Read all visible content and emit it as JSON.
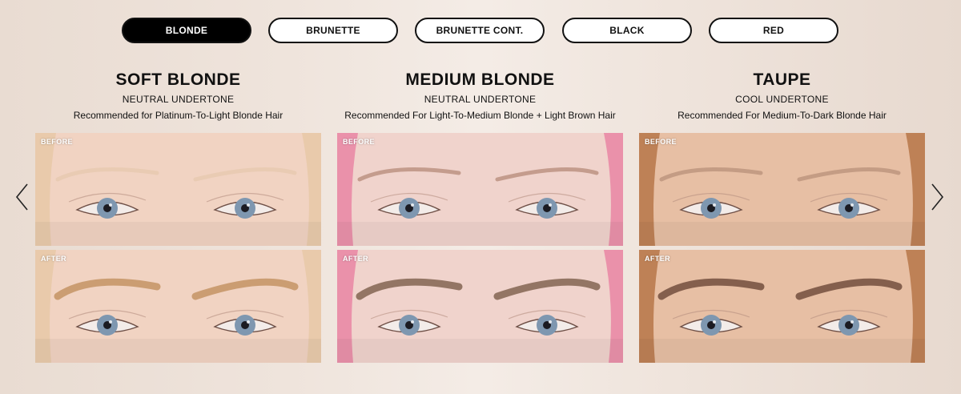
{
  "tabs": [
    "BLONDE",
    "BRUNETTE",
    "BRUNETTE CONT.",
    "BLACK",
    "RED"
  ],
  "active_tab": "BLONDE",
  "shades": [
    {
      "name": "SOFT BLONDE",
      "undertone": "NEUTRAL UNDERTONE",
      "recommendation": "Recommended for Platinum-To-Light Blonde Hair",
      "before_label": "BEFORE",
      "after_label": "AFTER",
      "skin": "#f1d3c2",
      "hair": "#e8c9a8",
      "brow_before": "#e6c8ae",
      "brow_after": "#c89a6e"
    },
    {
      "name": "MEDIUM BLONDE",
      "undertone": "NEUTRAL UNDERTONE",
      "recommendation": "Recommended For Light-To-Medium Blonde + Light Brown Hair",
      "before_label": "BEFORE",
      "after_label": "AFTER",
      "skin": "#f0d3cc",
      "hair": "#e98aa6",
      "brow_before": "#b68a78",
      "brow_after": "#8d705e"
    },
    {
      "name": "TAUPE",
      "undertone": "COOL UNDERTONE",
      "recommendation": "Recommended For Medium-To-Dark Blonde Hair",
      "before_label": "BEFORE",
      "after_label": "AFTER",
      "skin": "#e7bfa4",
      "hair": "#b97a4e",
      "brow_before": "#b8907a",
      "brow_after": "#7e5a49"
    }
  ],
  "icons": {
    "prev": "chevron-left-icon",
    "next": "chevron-right-icon"
  },
  "colors": {
    "active_tab_bg": "#000000",
    "tab_border": "#111111",
    "eye_iris": "#7e97b0"
  }
}
